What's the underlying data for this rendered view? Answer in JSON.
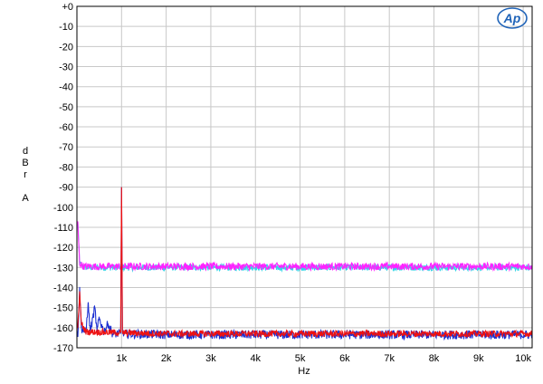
{
  "chart_data": {
    "type": "line",
    "title": "",
    "xlabel": "Hz",
    "ylabel_lines": [
      "d",
      "B",
      "r",
      "",
      "A"
    ],
    "xlim": [
      0,
      10200
    ],
    "ylim": [
      -170,
      0
    ],
    "x_ticks": [
      {
        "value": 1000,
        "label": "1k"
      },
      {
        "value": 2000,
        "label": "2k"
      },
      {
        "value": 3000,
        "label": "3k"
      },
      {
        "value": 4000,
        "label": "4k"
      },
      {
        "value": 5000,
        "label": "5k"
      },
      {
        "value": 6000,
        "label": "6k"
      },
      {
        "value": 7000,
        "label": "7k"
      },
      {
        "value": 8000,
        "label": "8k"
      },
      {
        "value": 9000,
        "label": "9k"
      },
      {
        "value": 10000,
        "label": "10k"
      }
    ],
    "y_ticks": [
      {
        "value": 0,
        "label": "+0"
      },
      {
        "value": -10,
        "label": "-10"
      },
      {
        "value": -20,
        "label": "-20"
      },
      {
        "value": -30,
        "label": "-30"
      },
      {
        "value": -40,
        "label": "-40"
      },
      {
        "value": -50,
        "label": "-50"
      },
      {
        "value": -60,
        "label": "-60"
      },
      {
        "value": -70,
        "label": "-70"
      },
      {
        "value": -80,
        "label": "-80"
      },
      {
        "value": -90,
        "label": "-90"
      },
      {
        "value": -100,
        "label": "-100"
      },
      {
        "value": -110,
        "label": "-110"
      },
      {
        "value": -120,
        "label": "-120"
      },
      {
        "value": -130,
        "label": "-130"
      },
      {
        "value": -140,
        "label": "-140"
      },
      {
        "value": -150,
        "label": "-150"
      },
      {
        "value": -160,
        "label": "-160"
      },
      {
        "value": -170,
        "label": "-170"
      }
    ],
    "grid": true,
    "legend": "none",
    "logo_text": "Ap",
    "series": [
      {
        "color": "#33d6e6",
        "points": [
          [
            20,
            -108
          ],
          [
            60,
            -128
          ],
          [
            150,
            -130
          ],
          [
            2000,
            -130
          ],
          [
            4000,
            -130
          ],
          [
            6000,
            -130
          ],
          [
            8000,
            -130
          ],
          [
            10000,
            -130
          ],
          [
            10200,
            -130
          ]
        ],
        "noise_amp": 1.6
      },
      {
        "color": "#ff22ff",
        "points": [
          [
            20,
            -108
          ],
          [
            60,
            -128
          ],
          [
            150,
            -129.5
          ],
          [
            2000,
            -129.5
          ],
          [
            4000,
            -129.5
          ],
          [
            6000,
            -129.5
          ],
          [
            8000,
            -129.5
          ],
          [
            10000,
            -129.5
          ],
          [
            10200,
            -129.5
          ]
        ],
        "noise_amp": 1.8
      },
      {
        "color": "#1b2fd1",
        "points": [
          [
            20,
            -163
          ],
          [
            60,
            -141
          ],
          [
            100,
            -160
          ],
          [
            200,
            -163
          ],
          [
            250,
            -148
          ],
          [
            300,
            -162
          ],
          [
            400,
            -150
          ],
          [
            450,
            -162
          ],
          [
            500,
            -155
          ],
          [
            600,
            -162
          ],
          [
            700,
            -158
          ],
          [
            800,
            -163
          ],
          [
            980,
            -163
          ],
          [
            1000,
            -90
          ],
          [
            1020,
            -163
          ],
          [
            2000,
            -163.5
          ],
          [
            5000,
            -163.5
          ],
          [
            8000,
            -163.5
          ],
          [
            10200,
            -163.5
          ]
        ],
        "noise_amp": 2.2
      },
      {
        "color": "#ee1111",
        "points": [
          [
            20,
            -160
          ],
          [
            60,
            -143
          ],
          [
            100,
            -158
          ],
          [
            200,
            -162
          ],
          [
            980,
            -162.5
          ],
          [
            1000,
            -90
          ],
          [
            1020,
            -162.5
          ],
          [
            2000,
            -163
          ],
          [
            5000,
            -163
          ],
          [
            8000,
            -163
          ],
          [
            10200,
            -163
          ]
        ],
        "noise_amp": 1.6
      }
    ]
  }
}
